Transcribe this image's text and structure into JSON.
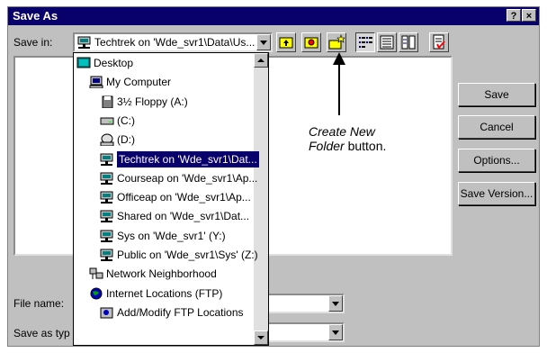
{
  "window": {
    "title": "Save As",
    "help_btn": "?",
    "close_btn": "×"
  },
  "save_in": {
    "label": "Save in:",
    "value": "Techtrek on 'Wde_svr1\\Data\\Us..."
  },
  "toolbar": {
    "tools": [
      "up-one-level-icon",
      "search-web-icon",
      "create-new-folder-icon",
      "list-view-icon",
      "details-view-icon",
      "properties-view-icon",
      "tools-icon"
    ]
  },
  "dropdown": {
    "items": [
      {
        "label": "Desktop",
        "icon": "desktop-icon",
        "level": 0
      },
      {
        "label": "My Computer",
        "icon": "computer-icon",
        "level": 1
      },
      {
        "label": "3½ Floppy (A:)",
        "icon": "floppy-icon",
        "level": 2
      },
      {
        "label": "(C:)",
        "icon": "drive-icon",
        "level": 2
      },
      {
        "label": "(D:)",
        "icon": "cdrom-icon",
        "level": 2
      },
      {
        "label": "Techtrek on 'Wde_svr1\\Dat...",
        "icon": "network-drive-icon",
        "level": 2,
        "selected": true
      },
      {
        "label": "Courseap on 'Wde_svr1\\Ap...",
        "icon": "network-drive-icon",
        "level": 2
      },
      {
        "label": "Officeap on 'Wde_svr1\\Ap...",
        "icon": "network-drive-icon",
        "level": 2
      },
      {
        "label": "Shared on 'Wde_svr1\\Dat...",
        "icon": "network-drive-icon",
        "level": 2
      },
      {
        "label": "Sys on 'Wde_svr1' (Y:)",
        "icon": "network-drive-icon",
        "level": 2
      },
      {
        "label": "Public on 'Wde_svr1\\Sys' (Z:)",
        "icon": "network-drive-icon",
        "level": 2
      },
      {
        "label": "Network Neighborhood",
        "icon": "network-neighborhood-icon",
        "level": 1
      },
      {
        "label": "Internet Locations (FTP)",
        "icon": "internet-icon",
        "level": 1
      },
      {
        "label": "Add/Modify FTP Locations",
        "icon": "ftp-icon",
        "level": 2
      }
    ]
  },
  "buttons": {
    "save": "Save",
    "cancel": "Cancel",
    "options": "Options...",
    "save_version": "Save Version..."
  },
  "file_name": {
    "label": "File name:",
    "value": ""
  },
  "save_as_type": {
    "label": "Save as typ",
    "value": ""
  },
  "annotation": {
    "line1": "Create New",
    "line2_italic": "Folder",
    "line2_rest": " button."
  },
  "colors": {
    "title_bar": "#08006b",
    "face": "#c0c0c0",
    "selection": "#08006b"
  }
}
